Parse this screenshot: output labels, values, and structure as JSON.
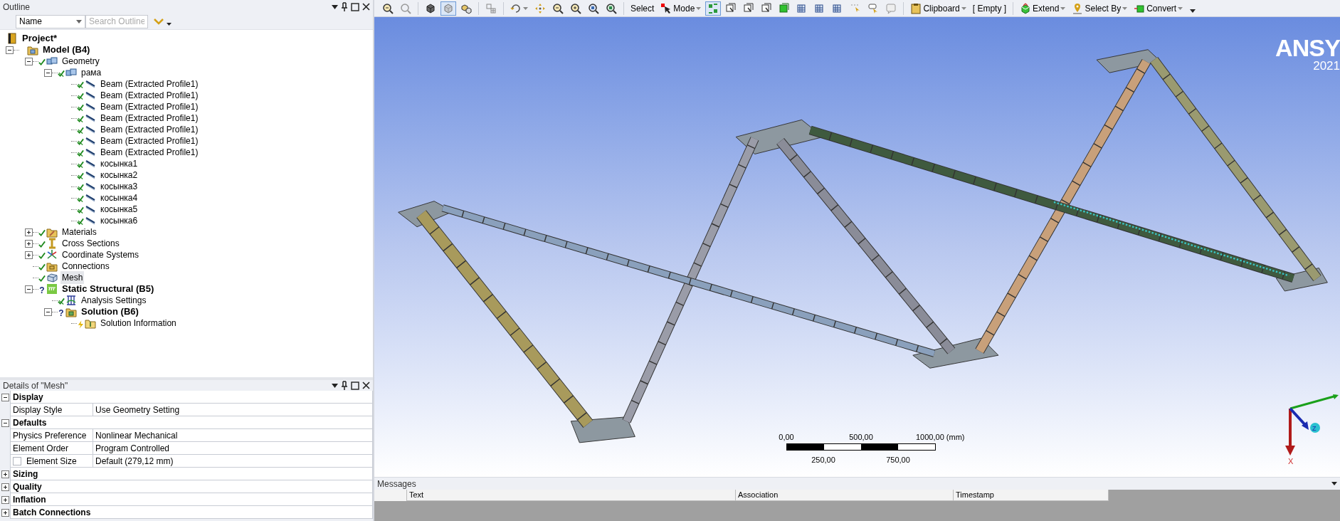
{
  "outline": {
    "title": "Outline",
    "filter": {
      "value": "Name"
    },
    "search": {
      "placeholder": "Search Outline"
    },
    "tree": [
      {
        "label": "Project*",
        "kind": "project",
        "bold": true,
        "children": [
          {
            "label": "Model (B4)",
            "kind": "model",
            "bold": true,
            "expanded": true,
            "children": [
              {
                "label": "Geometry",
                "kind": "geometry",
                "ok": true,
                "bold": false,
                "expanded": true,
                "children": [
                  {
                    "label": "рама",
                    "kind": "geometry",
                    "ok": true,
                    "bold": false,
                    "expanded": true,
                    "children": [
                      {
                        "label": "Beam (Extracted Profile1)",
                        "kind": "beam",
                        "ok": true,
                        "bold": false
                      },
                      {
                        "label": "Beam (Extracted Profile1)",
                        "kind": "beam",
                        "ok": true,
                        "bold": false
                      },
                      {
                        "label": "Beam (Extracted Profile1)",
                        "kind": "beam",
                        "ok": true,
                        "bold": false
                      },
                      {
                        "label": "Beam (Extracted Profile1)",
                        "kind": "beam",
                        "ok": true,
                        "bold": false
                      },
                      {
                        "label": "Beam (Extracted Profile1)",
                        "kind": "beam",
                        "ok": true,
                        "bold": false
                      },
                      {
                        "label": "Beam (Extracted Profile1)",
                        "kind": "beam",
                        "ok": true,
                        "bold": false
                      },
                      {
                        "label": "Beam (Extracted Profile1)",
                        "kind": "beam",
                        "ok": true,
                        "bold": false
                      },
                      {
                        "label": "косынка1",
                        "kind": "beam",
                        "ok": true,
                        "bold": false
                      },
                      {
                        "label": "косынка2",
                        "kind": "beam",
                        "ok": true,
                        "bold": false
                      },
                      {
                        "label": "косынка3",
                        "kind": "beam",
                        "ok": true,
                        "bold": false
                      },
                      {
                        "label": "косынка4",
                        "kind": "beam",
                        "ok": true,
                        "bold": false
                      },
                      {
                        "label": "косынка5",
                        "kind": "beam",
                        "ok": true,
                        "bold": false
                      },
                      {
                        "label": "косынка6",
                        "kind": "beam",
                        "ok": true,
                        "bold": false
                      }
                    ]
                  }
                ]
              },
              {
                "label": "Materials",
                "kind": "materials",
                "ok": true,
                "bold": false,
                "expanded": false
              },
              {
                "label": "Cross Sections",
                "kind": "cross_sections",
                "ok": true,
                "bold": false,
                "expanded": false
              },
              {
                "label": "Coordinate Systems",
                "kind": "coordinates",
                "ok": true,
                "bold": false,
                "expanded": false
              },
              {
                "label": "Connections",
                "kind": "connections",
                "ok": true,
                "bold": false
              },
              {
                "label": "Mesh",
                "kind": "mesh",
                "ok": true,
                "bold": false,
                "selected": true
              },
              {
                "label": "Static Structural (B5)",
                "kind": "static",
                "ok": false,
                "status_text": "?",
                "bold": true,
                "expanded": true,
                "children": [
                  {
                    "label": "Analysis Settings",
                    "kind": "analysis",
                    "ok": true,
                    "bold": false
                  },
                  {
                    "label": "Solution (B6)",
                    "kind": "solution",
                    "ok": false,
                    "status_text": "?",
                    "bold": true,
                    "expanded": true,
                    "children": [
                      {
                        "label": "Solution Information",
                        "kind": "solution_info",
                        "ok": false,
                        "pending": true,
                        "bold": false
                      }
                    ]
                  }
                ]
              }
            ]
          }
        ]
      }
    ]
  },
  "details": {
    "title": "Details of \"Mesh\"",
    "groups": [
      {
        "label": "Display",
        "expanded": true,
        "rows": [
          {
            "label": "Display Style",
            "value": "Use Geometry Setting"
          }
        ]
      },
      {
        "label": "Defaults",
        "expanded": true,
        "rows": [
          {
            "label": "Physics Preference",
            "value": "Nonlinear Mechanical"
          },
          {
            "label": "Element Order",
            "value": "Program Controlled"
          },
          {
            "label": "Element Size",
            "value": "Default (279,12 mm)",
            "kind": "checkbox",
            "checked": false
          }
        ]
      },
      {
        "label": "Sizing",
        "expanded": false
      },
      {
        "label": "Quality",
        "expanded": false
      },
      {
        "label": "Inflation",
        "expanded": false
      },
      {
        "label": "Batch Connections",
        "expanded": false
      }
    ]
  },
  "toolbar": [
    {
      "kind": "zoom_in",
      "selected": false
    },
    {
      "kind": "zoom_out",
      "selected": false
    },
    {
      "kind": "separator"
    },
    {
      "kind": "box",
      "selected": false
    },
    {
      "kind": "box_light",
      "selected": true
    },
    {
      "kind": "explode",
      "selected": false
    },
    {
      "kind": "separator"
    },
    {
      "kind": "grid",
      "selected": false
    },
    {
      "kind": "separator"
    },
    {
      "kind": "rotate",
      "dropdown": true,
      "selected": false
    },
    {
      "kind": "pan",
      "selected": false
    },
    {
      "kind": "zoom_in",
      "selected": false
    },
    {
      "kind": "zoom_plus",
      "selected": false
    },
    {
      "kind": "zoom_box",
      "selected": false
    },
    {
      "kind": "zoom_fit",
      "selected": false
    },
    {
      "kind": "separator"
    },
    {
      "kind": "plain",
      "label": "Select",
      "selected": false
    },
    {
      "kind": "cursor",
      "label": "Mode",
      "dropdown": true,
      "selected": false
    },
    {
      "kind": "select_points",
      "selected": true
    },
    {
      "kind": "box_cursor",
      "selected": false
    },
    {
      "kind": "box_cursor",
      "selected": false
    },
    {
      "kind": "box_cursor",
      "selected": false
    },
    {
      "kind": "box_green",
      "selected": false
    },
    {
      "kind": "box_mesh",
      "selected": false
    },
    {
      "kind": "box_mesh",
      "selected": false
    },
    {
      "kind": "box_mesh",
      "selected": false
    },
    {
      "kind": "xyz_cursor",
      "selected": false
    },
    {
      "kind": "label_cursor",
      "selected": false
    },
    {
      "kind": "annotation",
      "selected": false
    },
    {
      "kind": "separator"
    },
    {
      "kind": "clipboard",
      "label": "Clipboard",
      "dropdown": true,
      "selected": false
    },
    {
      "kind": "plain",
      "label": "[ Empty ]",
      "selected": false
    },
    {
      "kind": "separator"
    },
    {
      "kind": "extend",
      "label": "Extend",
      "dropdown": true,
      "selected": false
    },
    {
      "kind": "pin",
      "label": "Select By",
      "dropdown": true,
      "selected": false
    },
    {
      "kind": "convert",
      "label": "Convert",
      "dropdown": true,
      "selected": false
    }
  ],
  "viewport": {
    "logo": "ANSY",
    "version": "2021",
    "scale": {
      "top_labels": [
        "0,00",
        "500,00",
        "1000,00 (mm)"
      ],
      "bottom_labels": [
        "250,00",
        "750,00"
      ]
    },
    "triad": {
      "x_label": "X",
      "z_label": "Z"
    }
  },
  "messages": {
    "title": "Messages",
    "columns": [
      "Text",
      "Association",
      "Timestamp"
    ]
  }
}
